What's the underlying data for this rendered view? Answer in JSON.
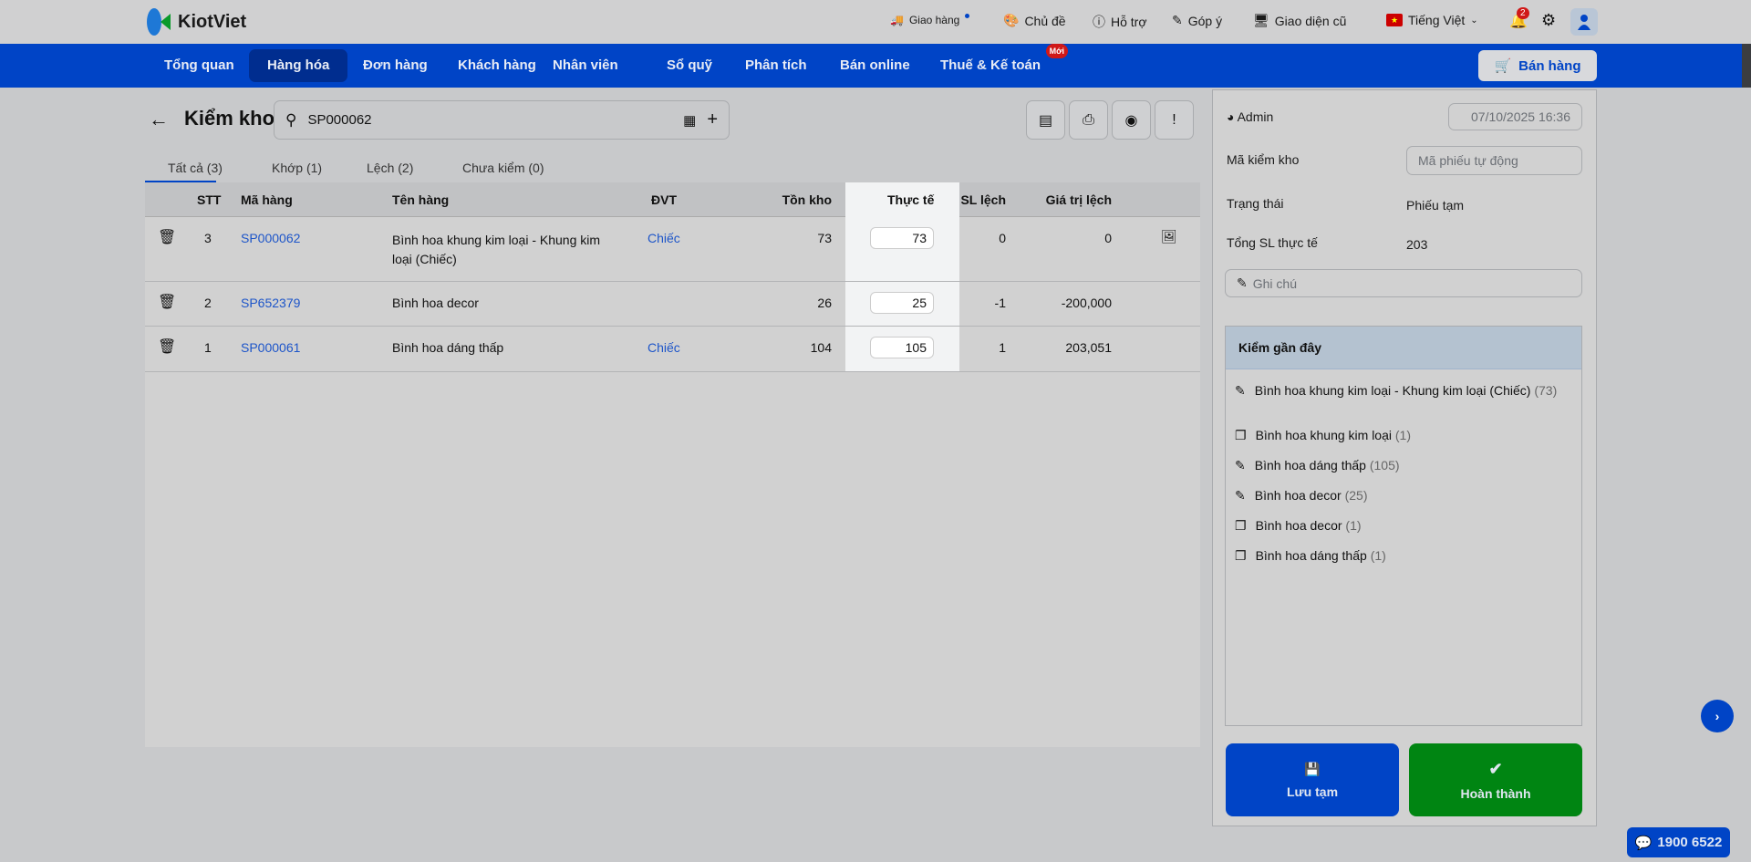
{
  "header": {
    "brand": "KiotViet",
    "links": [
      {
        "label": "Giao hàng",
        "icon": "delivery-icon"
      },
      {
        "label": "Chủ đề",
        "icon": "palette-icon"
      },
      {
        "label": "Hỗ trợ",
        "icon": "support-icon"
      },
      {
        "label": "Góp ý",
        "icon": "feedback-icon"
      },
      {
        "label": "Giao diện cũ",
        "icon": "monitor-icon"
      }
    ],
    "language": "Tiếng Việt",
    "notifications": "2"
  },
  "nav": {
    "items": [
      "Tổng quan",
      "Hàng hóa",
      "Đơn hàng",
      "Khách hàng",
      "Nhân viên",
      "Sổ quỹ",
      "Phân tích",
      "Bán online",
      "Thuế & Kế toán"
    ],
    "new_badge": "Mới",
    "active": "Hàng hóa",
    "sell_button": "Bán hàng"
  },
  "page": {
    "title": "Kiểm kho",
    "search_value": "SP000062"
  },
  "tabs": [
    "Tất cả (3)",
    "Khớp (1)",
    "Lệch (2)",
    "Chưa kiểm (0)"
  ],
  "table": {
    "headers": [
      "STT",
      "Mã hàng",
      "Tên hàng",
      "ĐVT",
      "Tồn kho",
      "Thực tế",
      "SL lệch",
      "Giá trị lệch"
    ],
    "rows": [
      {
        "stt": "3",
        "code": "SP000062",
        "name": "Bình hoa khung kim loại - Khung kim loại (Chiếc)",
        "unit": "Chiếc",
        "stock": "73",
        "actual": "73",
        "diff": "0",
        "value": "0"
      },
      {
        "stt": "2",
        "code": "SP652379",
        "name": "Bình hoa decor",
        "unit": "",
        "stock": "26",
        "actual": "25",
        "diff": "-1",
        "value": "-200,000"
      },
      {
        "stt": "1",
        "code": "SP000061",
        "name": "Bình hoa dáng thấp",
        "unit": "Chiếc",
        "stock": "104",
        "actual": "105",
        "diff": "1",
        "value": "203,051"
      }
    ]
  },
  "side": {
    "user": "Admin",
    "date": "07/10/2025 16:36",
    "code_label": "Mã kiểm kho",
    "code_placeholder": "Mã phiếu tự động",
    "status_label": "Trạng thái",
    "status_value": "Phiếu tạm",
    "total_label": "Tổng SL thực tế",
    "total_value": "203",
    "note_placeholder": "Ghi chú",
    "recent_title": "Kiểm gần đây",
    "recent": [
      {
        "name": "Bình hoa khung kim loại - Khung kim loại (Chiếc)",
        "count": "(73)",
        "icon": "pencil-icon"
      },
      {
        "name": "Bình hoa khung kim loại",
        "count": "(1)",
        "icon": "copy-icon"
      },
      {
        "name": "Bình hoa dáng thấp",
        "count": "(105)",
        "icon": "pencil-icon"
      },
      {
        "name": "Bình hoa decor",
        "count": "(25)",
        "icon": "pencil-icon"
      },
      {
        "name": "Bình hoa decor",
        "count": "(1)",
        "icon": "copy-icon"
      },
      {
        "name": "Bình hoa dáng thấp",
        "count": "(1)",
        "icon": "copy-icon"
      }
    ],
    "save_label": "Lưu tạm",
    "complete_label": "Hoàn thành"
  },
  "hotline": "1900 6522",
  "colors": {
    "brand": "#0044c6",
    "active_nav": "#002d8f",
    "complete": "#008512",
    "link": "#1d55c9"
  }
}
